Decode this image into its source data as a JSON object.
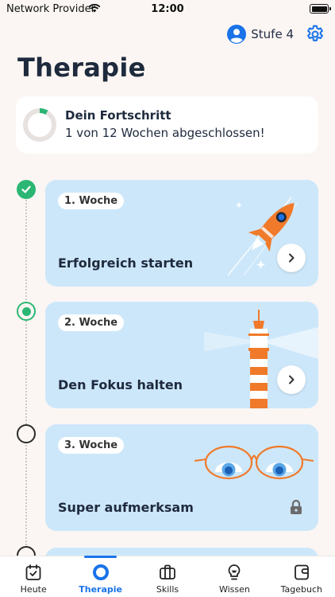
{
  "status_bar": {
    "carrier": "Network Provider",
    "time": "12:00"
  },
  "header": {
    "level_label": "Stufe 4",
    "title": "Therapie"
  },
  "progress": {
    "title": "Dein Fortschritt",
    "subtitle": "1 von 12 Wochen abgeschlossen!",
    "completed": 1,
    "total": 12
  },
  "weeks": [
    {
      "badge": "1. Woche",
      "name": "Erfolgreich starten",
      "status": "completed"
    },
    {
      "badge": "2. Woche",
      "name": "Den Fokus halten",
      "status": "current"
    },
    {
      "badge": "3. Woche",
      "name": "Super aufmerksam",
      "status": "locked"
    }
  ],
  "tabs": [
    {
      "label": "Heute",
      "icon": "calendar-check-icon"
    },
    {
      "label": "Therapie",
      "icon": "ring-icon"
    },
    {
      "label": "Skills",
      "icon": "briefcase-icon"
    },
    {
      "label": "Wissen",
      "icon": "lightbulb-icon"
    },
    {
      "label": "Tagebuch",
      "icon": "journal-icon"
    }
  ],
  "colors": {
    "accent": "#1a73e8",
    "success": "#2bb673",
    "card": "#cde7fa",
    "background": "#fbf6f3",
    "illustration_orange": "#f07a2a"
  }
}
